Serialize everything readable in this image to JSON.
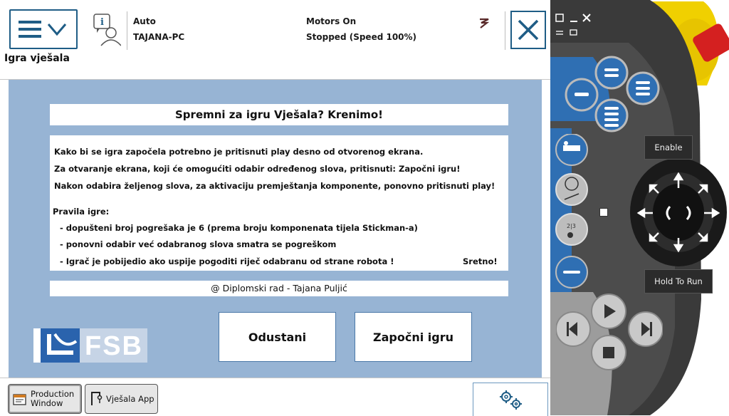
{
  "header": {
    "mode": "Auto",
    "system_name": "TAJANA-PC",
    "motors": "Motors On",
    "state": "Stopped (Speed 100%)"
  },
  "screen_title": "Igra vješala",
  "panel": {
    "title": "Spremni za igru Vješala? Krenimo!",
    "instructions": [
      "Kako bi se igra započela potrebno je pritisnuti play desno od otvorenog ekrana.",
      "Za otvaranje ekrana, koji će omogućiti odabir određenog slova, pritisnuti: Započni igru!",
      "Nakon odabira željenog slova, za aktivaciju premještanja komponente, ponovno pritisnuti play!"
    ],
    "rules_heading": "Pravila igre:",
    "rules": [
      "- dopušteni broj pogrešaka je 6 (prema broju komponenata tijela Stickman-a)",
      "- ponovni odabir već odabranog slova smatra se pogreškom",
      "- Igrač je pobijedio ako uspije pogoditi riječ odabranu od strane robota !"
    ],
    "good_luck": "Sretno!",
    "footer": "@ Diplomski rad - Tajana Puljić"
  },
  "logo_text": "FSB",
  "buttons": {
    "quit": "Odustani",
    "start": "Započni igru"
  },
  "taskbar": {
    "production_line1": "Production",
    "production_line2": "Window",
    "app_label": "Vješala App"
  },
  "controller": {
    "enable_label": "Enable",
    "hold_to_run_label": "Hold To Run"
  },
  "colors": {
    "app_background": "#97b4d4",
    "accent_blue": "#1f5d86",
    "controller_blue": "#2f6fb3",
    "estop_red": "#d42020",
    "yellow": "#f0d000"
  }
}
